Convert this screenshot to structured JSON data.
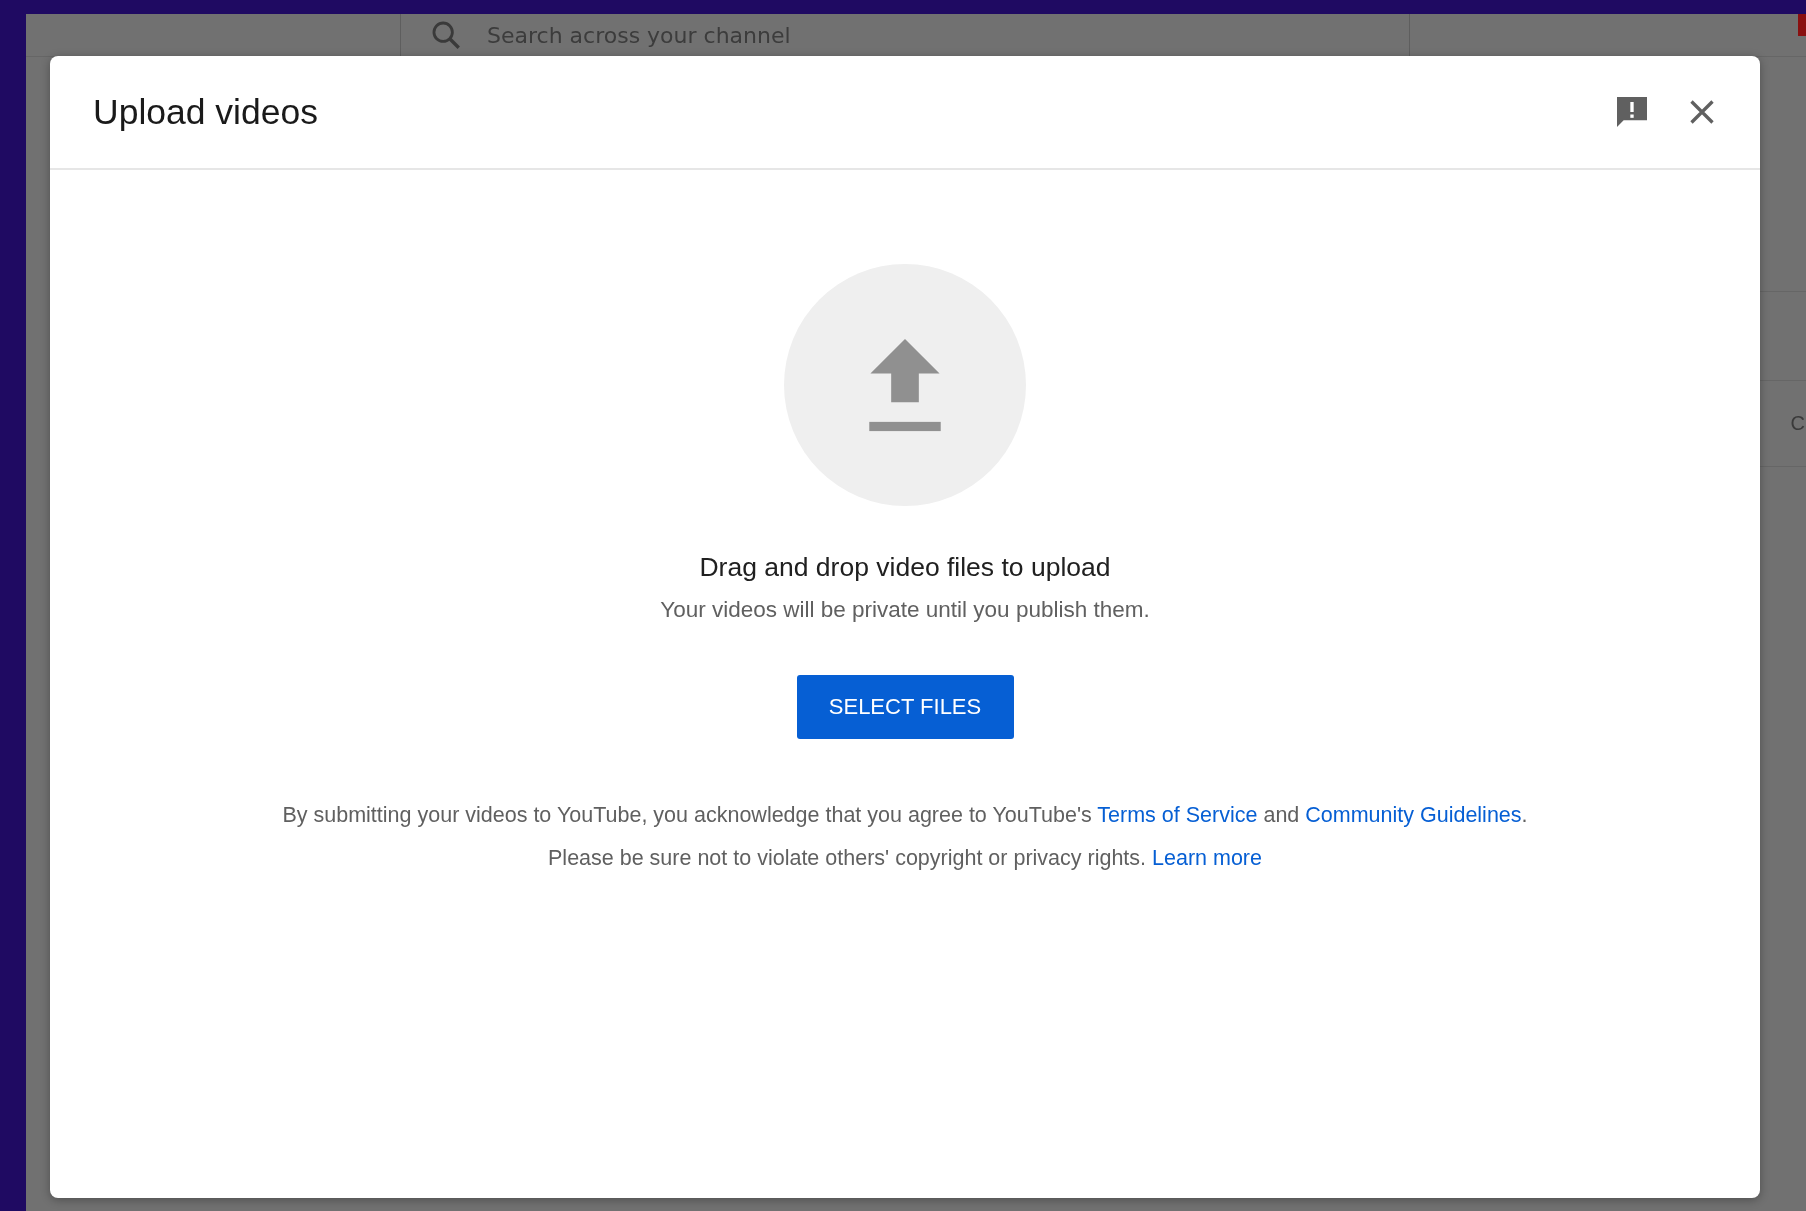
{
  "background_page": {
    "search": {
      "placeholder": "Search across your channel"
    },
    "edge_text": "C"
  },
  "dialog": {
    "title": "Upload videos",
    "heading": "Drag and drop video files to upload",
    "subheading": "Your videos will be private until you publish them.",
    "button": "SELECT FILES",
    "legal": [
      {
        "text": "By submitting your videos to YouTube, you acknowledge that you agree to YouTube's ",
        "links": [
          "Terms of Service",
          "Community Guidelines"
        ],
        "joiner": " and ",
        "end": "."
      },
      {
        "text": "Please be sure not to violate others' copyright or privacy rights. ",
        "links": [
          "Learn more"
        ]
      }
    ]
  }
}
